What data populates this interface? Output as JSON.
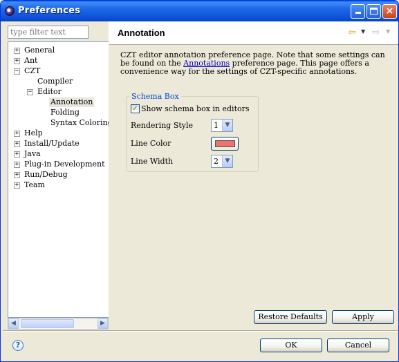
{
  "window": {
    "title": "Preferences",
    "controls": {
      "minimize": "minimize",
      "maximize": "maximize",
      "close": "×"
    }
  },
  "sidebar": {
    "filter_placeholder": "type filter text",
    "tree": [
      {
        "label": "General",
        "expander": "+"
      },
      {
        "label": "Ant",
        "expander": "+"
      },
      {
        "label": "CZT",
        "expander": "−"
      },
      {
        "label": "Compiler",
        "expander": ""
      },
      {
        "label": "Editor",
        "expander": "−"
      },
      {
        "label": "Annotation",
        "expander": "",
        "selected": true
      },
      {
        "label": "Folding",
        "expander": ""
      },
      {
        "label": "Syntax Coloring",
        "expander": ""
      },
      {
        "label": "Help",
        "expander": "+"
      },
      {
        "label": "Install/Update",
        "expander": "+"
      },
      {
        "label": "Java",
        "expander": "+"
      },
      {
        "label": "Plug-in Development",
        "expander": "+"
      },
      {
        "label": "Run/Debug",
        "expander": "+"
      },
      {
        "label": "Team",
        "expander": "+"
      }
    ],
    "scroll_left": "◀",
    "scroll_right": "▶"
  },
  "page": {
    "title": "Annotation",
    "nav_back": "⇦",
    "nav_forward": "⇨",
    "nav_dropdown": "▼",
    "description_pre": "CZT editor annotation preference page. Note that some settings can be found on the ",
    "description_link": "Annotations",
    "description_post": " preference page. This page offers a convenience way for the settings of CZT-specific annotations.",
    "group": {
      "title": "Schema Box",
      "checkbox_label": "Show schema box in editors",
      "checkbox_mark": "✓",
      "checkbox_checked": true,
      "rendering_style_label": "Rendering Style",
      "rendering_style_value": "1",
      "line_color_label": "Line Color",
      "line_color_value": "#f07070",
      "line_width_label": "Line Width",
      "line_width_value": "2",
      "combo_arrow": "▼"
    },
    "restore_defaults": "Restore Defaults",
    "apply": "Apply"
  },
  "footer": {
    "help": "?",
    "ok": "OK",
    "cancel": "Cancel"
  }
}
